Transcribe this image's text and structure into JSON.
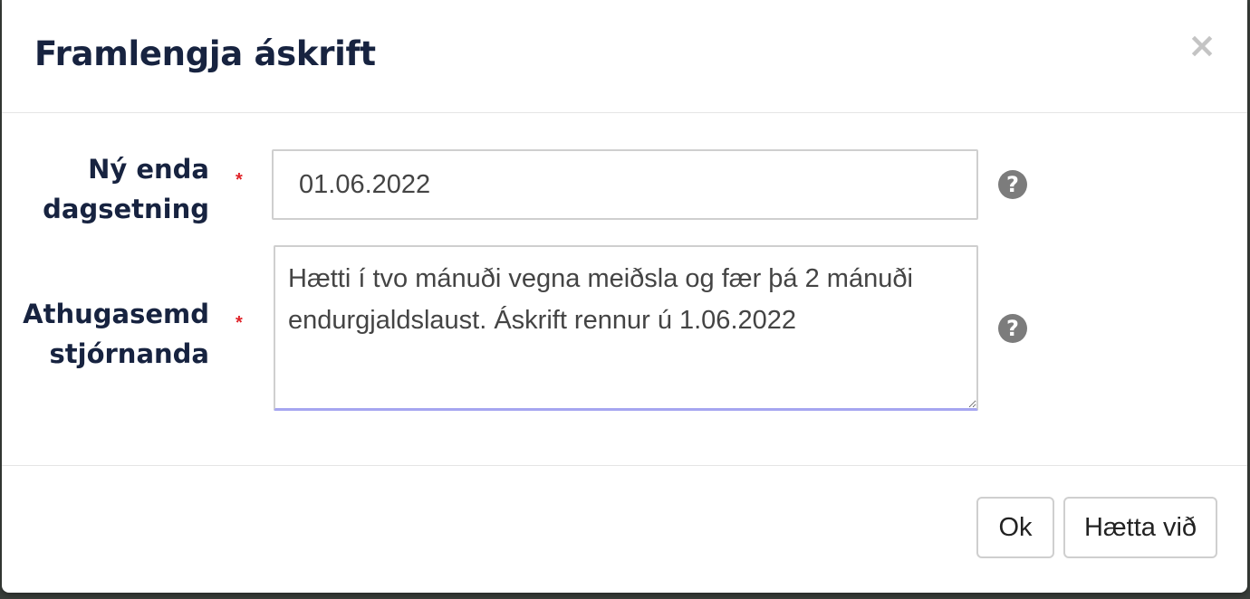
{
  "dialog": {
    "title": "Framlengja áskrift",
    "close_label": "×"
  },
  "form": {
    "end_date": {
      "label": "Ný enda dagsetning",
      "required_marker": "*",
      "value": "01.06.2022",
      "help_icon": "question-circle-icon",
      "help_glyph": "?"
    },
    "comment": {
      "label": "Athugasemd stjórnanda",
      "required_marker": "*",
      "value": "Hætti í tvo mánuði vegna meiðsla og fær þá 2 mánuði endurgjaldslaust. Áskrift rennur ú 1.06.2022",
      "help_icon": "question-circle-icon",
      "help_glyph": "?"
    }
  },
  "footer": {
    "ok_label": "Ok",
    "cancel_label": "Hætta við"
  },
  "colors": {
    "title": "#172340",
    "required": "#e0242a",
    "focus_underline": "#a6a6f0",
    "help_icon": "#7c7c7c"
  }
}
